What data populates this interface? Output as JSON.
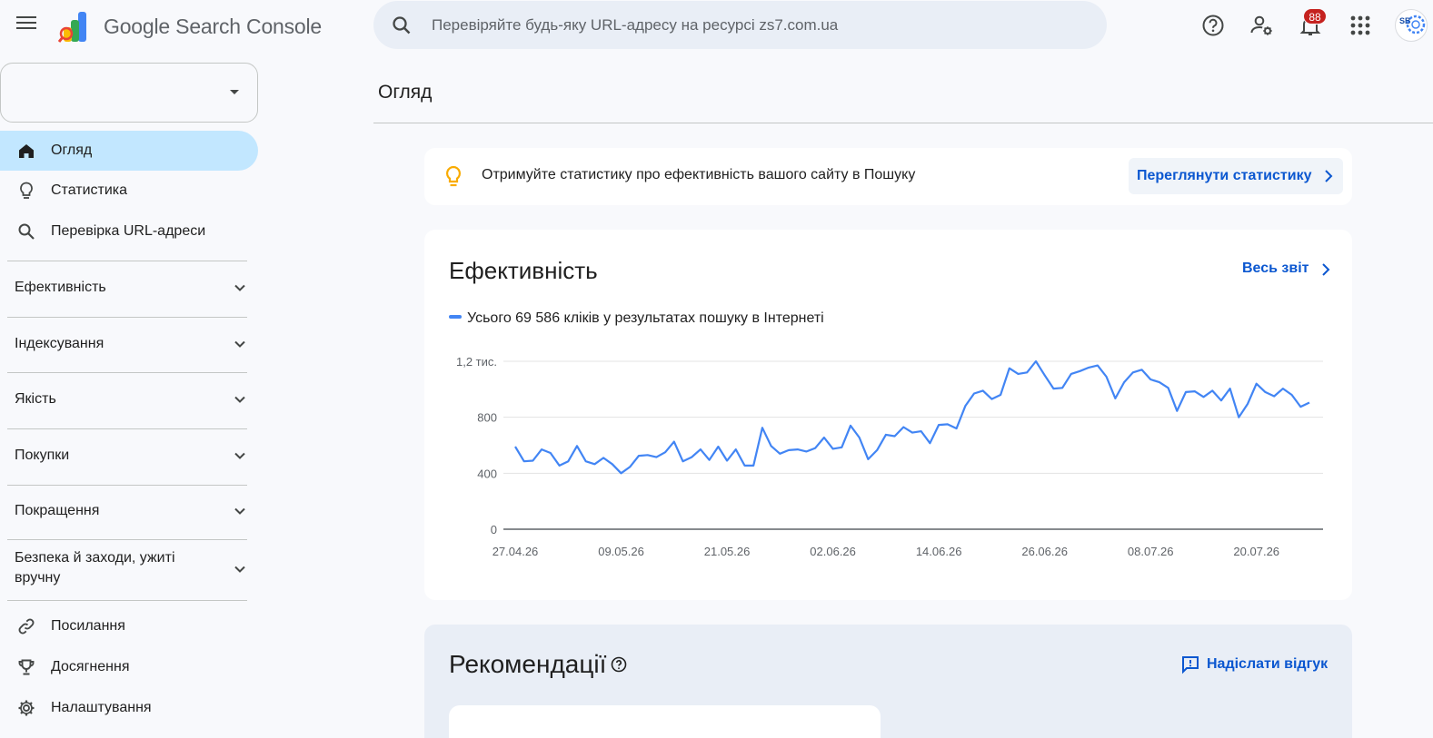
{
  "app": {
    "title_google": "Google",
    "title_product": "Search Console"
  },
  "search": {
    "placeholder": "Перевіряйте будь-яку URL-адресу на ресурсі zs7.com.ua"
  },
  "header": {
    "notifications_count": "88",
    "icons": [
      "help-icon",
      "manage-users-icon",
      "notifications-icon",
      "apps-grid-icon"
    ],
    "avatar_text": "SB"
  },
  "sidebar": {
    "property_value": "",
    "top_items": [
      {
        "label": "Огляд",
        "icon": "home-icon",
        "active": true
      },
      {
        "label": "Статистика",
        "icon": "lightbulb-icon",
        "active": false
      },
      {
        "label": "Перевірка URL-адреси",
        "icon": "search-icon",
        "active": false
      }
    ],
    "sections": [
      {
        "label": "Ефективність"
      },
      {
        "label": "Індексування"
      },
      {
        "label": "Якість"
      },
      {
        "label": "Покупки"
      },
      {
        "label": "Покращення"
      },
      {
        "label": "Безпека й заходи, ужиті вручну"
      }
    ],
    "bottom_items": [
      {
        "label": "Посилання",
        "icon": "link-icon"
      },
      {
        "label": "Досягнення",
        "icon": "trophy-icon"
      },
      {
        "label": "Налаштування",
        "icon": "settings-gear-icon"
      }
    ]
  },
  "main": {
    "page_title": "Огляд",
    "insight": {
      "text": "Отримуйте статистику про ефективність вашого сайту в Пошуку",
      "button": "Переглянути статистику"
    },
    "performance": {
      "title": "Ефективність",
      "full_report": "Весь звіт",
      "legend": "Усього 69 586 кліків у результатах пошуку в Інтернеті"
    },
    "recommendations": {
      "title": "Рекомендації",
      "feedback": "Надіслати відгук"
    }
  },
  "colors": {
    "accent": "#0b57d0",
    "series": "#4285f4",
    "active_nav": "#c2e7ff",
    "badge": "#c5221f"
  },
  "chart_data": {
    "type": "line",
    "series": [
      {
        "name": "Усього 69 586 кліків у результатах пошуку в Інтернеті",
        "values": [
          590,
          485,
          490,
          570,
          545,
          455,
          485,
          595,
          485,
          465,
          510,
          465,
          400,
          445,
          525,
          530,
          515,
          550,
          625,
          485,
          515,
          570,
          495,
          590,
          490,
          570,
          455,
          455,
          725,
          595,
          540,
          565,
          570,
          555,
          580,
          655,
          575,
          585,
          740,
          655,
          500,
          565,
          675,
          665,
          730,
          690,
          700,
          615,
          745,
          750,
          720,
          880,
          970,
          990,
          930,
          960,
          1150,
          1110,
          1120,
          1200,
          1100,
          1005,
          1010,
          1110,
          1130,
          1155,
          1170,
          1090,
          935,
          1050,
          1120,
          1140,
          1070,
          1050,
          1010,
          845,
          980,
          985,
          945,
          990,
          920,
          1005,
          800,
          895,
          1040,
          980,
          950,
          1005,
          960,
          875,
          905
        ]
      }
    ],
    "x_tick_labels": [
      "27.04.26",
      "09.05.26",
      "21.05.26",
      "02.06.26",
      "14.06.26",
      "26.06.26",
      "08.07.26",
      "20.07.26"
    ],
    "y_tick_labels": [
      "0",
      "400",
      "800",
      "1,2 тис."
    ],
    "y_ticks": [
      0,
      400,
      800,
      1200
    ],
    "ylim": [
      0,
      1200
    ],
    "grid": true
  }
}
